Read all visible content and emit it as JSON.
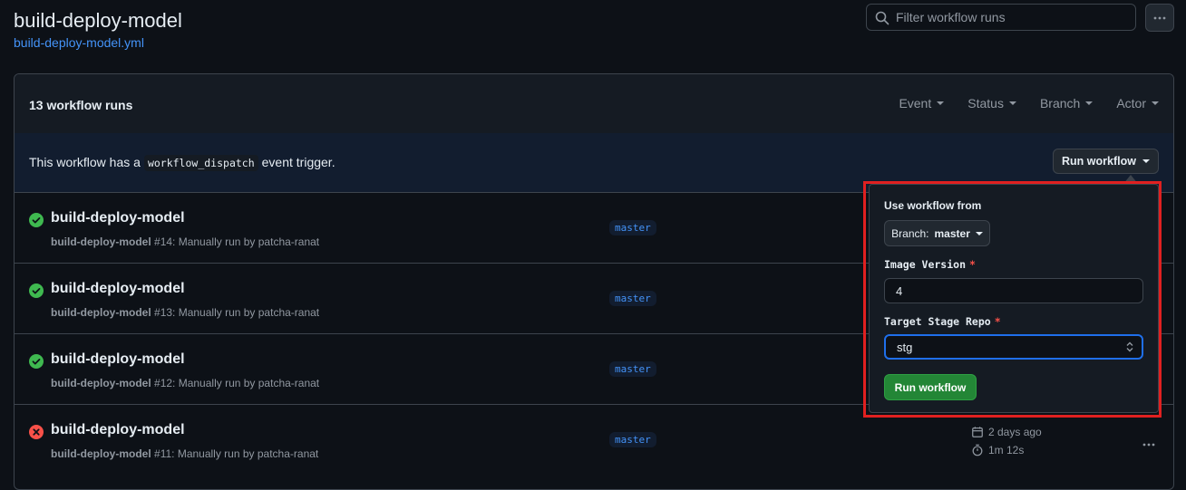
{
  "header": {
    "title": "build-deploy-model",
    "file_link": "build-deploy-model.yml",
    "filter_placeholder": "Filter workflow runs"
  },
  "list": {
    "count_label": "13 workflow runs",
    "filters": [
      "Event",
      "Status",
      "Branch",
      "Actor"
    ]
  },
  "dispatch": {
    "text_before": "This workflow has a",
    "code": "workflow_dispatch",
    "text_after": "event trigger.",
    "button_label": "Run workflow"
  },
  "runs": [
    {
      "title": "build-deploy-model",
      "workflow": "build-deploy-model",
      "number": "#14",
      "desc": ": Manually run by patcha-ranat",
      "branch": "master",
      "status": "success"
    },
    {
      "title": "build-deploy-model",
      "workflow": "build-deploy-model",
      "number": "#13",
      "desc": ": Manually run by patcha-ranat",
      "branch": "master",
      "status": "success"
    },
    {
      "title": "build-deploy-model",
      "workflow": "build-deploy-model",
      "number": "#12",
      "desc": ": Manually run by patcha-ranat",
      "branch": "master",
      "status": "success"
    },
    {
      "title": "build-deploy-model",
      "workflow": "build-deploy-model",
      "number": "#11",
      "desc": ": Manually run by patcha-ranat",
      "branch": "master",
      "status": "failure",
      "time_ago": "2 days ago",
      "duration": "1m 12s"
    }
  ],
  "popup": {
    "use_from_label": "Use workflow from",
    "branch_prefix": "Branch:",
    "branch_value": "master",
    "image_version_label": "Image Version",
    "image_version_value": "4",
    "target_repo_label": "Target Stage Repo",
    "target_repo_value": "stg",
    "required_mark": "*",
    "submit_label": "Run workflow"
  },
  "colors": {
    "background": "#0d1117",
    "link": "#4493f8",
    "success": "#3fb950",
    "failure": "#f85149",
    "primary_button": "#238636",
    "highlight_box": "#e02020"
  }
}
